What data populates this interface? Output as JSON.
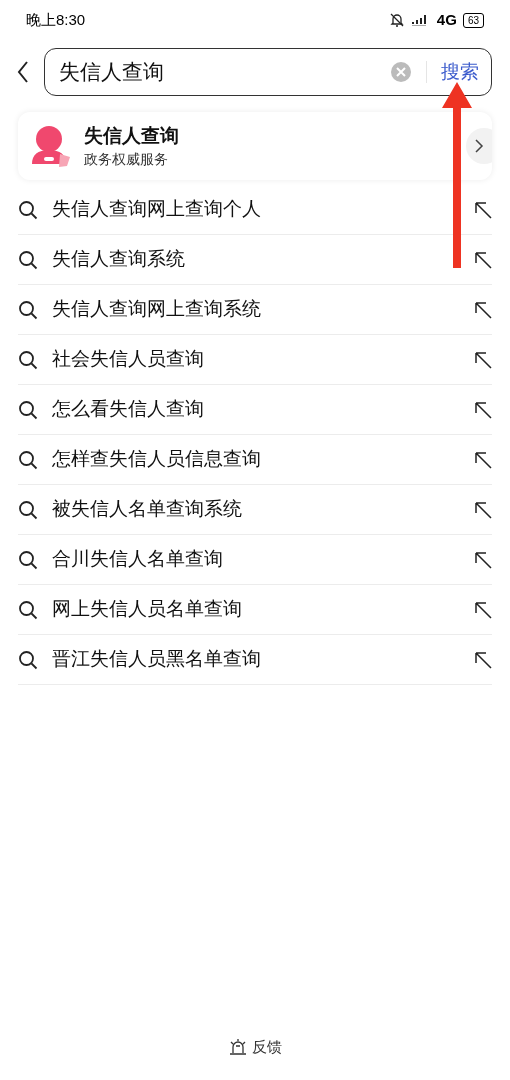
{
  "status_bar": {
    "time": "晚上8:30",
    "network": "4G",
    "battery": "63"
  },
  "search": {
    "value": "失信人查询",
    "button": "搜索"
  },
  "service_card": {
    "title": "失信人查询",
    "subtitle": "政务权威服务"
  },
  "suggestions": [
    {
      "text": "失信人查询网上查询个人"
    },
    {
      "text": "失信人查询系统"
    },
    {
      "text": "失信人查询网上查询系统"
    },
    {
      "text": "社会失信人员查询"
    },
    {
      "text": "怎么看失信人查询"
    },
    {
      "text": "怎样查失信人员信息查询"
    },
    {
      "text": "被失信人名单查询系统"
    },
    {
      "text": "合川失信人名单查询"
    },
    {
      "text": "网上失信人员名单查询"
    },
    {
      "text": "晋江失信人员黑名单查询"
    }
  ],
  "footer": {
    "feedback": "反馈"
  }
}
